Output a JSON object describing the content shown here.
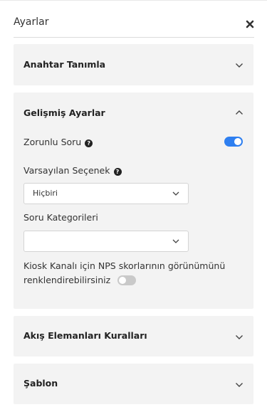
{
  "header": {
    "title": "Ayarlar"
  },
  "panels": {
    "anahtar": {
      "title": "Anahtar Tanımla"
    },
    "gelismis": {
      "title": "Gelişmiş Ayarlar",
      "zorunlu_soru": {
        "label": "Zorunlu Soru",
        "enabled": true
      },
      "varsayilan_secenek": {
        "label": "Varsayılan Seçenek",
        "value": "Hiçbiri"
      },
      "soru_kategorileri": {
        "label": "Soru Kategorileri",
        "value": ""
      },
      "kiosk_nps": {
        "label_line1": "Kiosk Kanalı için NPS skorlarının görünümünü",
        "label_line2": "renklendirebilirsiniz",
        "enabled": false
      }
    },
    "akis": {
      "title": "Akış Elemanları Kuralları"
    },
    "sablon": {
      "title": "Şablon"
    }
  },
  "colors": {
    "accent": "#2e7ff0",
    "panel_bg": "#f3f3f3",
    "toggle_off": "#c9c9c9"
  },
  "icons": {
    "close": "close-icon",
    "expand": "chevron-down-icon",
    "collapse": "chevron-up-icon",
    "help": "help-icon"
  }
}
